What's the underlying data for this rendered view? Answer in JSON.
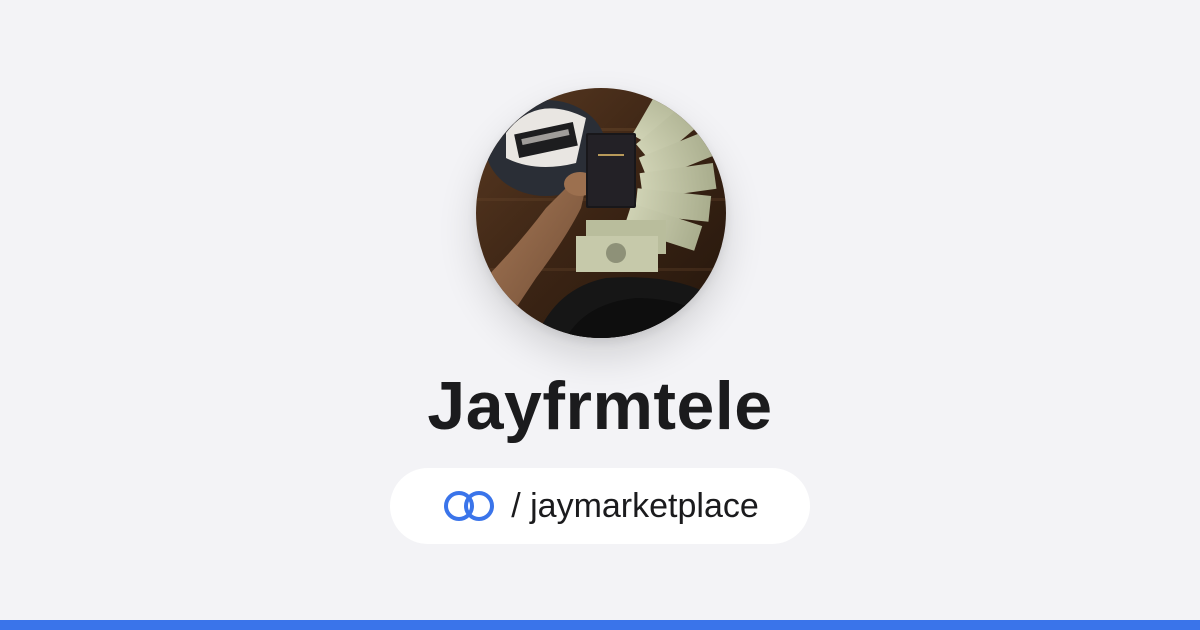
{
  "profile": {
    "name": "Jayfrmtele",
    "handle": "/ jaymarketplace",
    "link_icon": "link-rings-icon",
    "avatar_alt": "Profile photo"
  },
  "colors": {
    "background": "#f3f3f6",
    "accent": "#3a74ea",
    "text": "#1b1b1d",
    "pill": "#ffffff"
  }
}
